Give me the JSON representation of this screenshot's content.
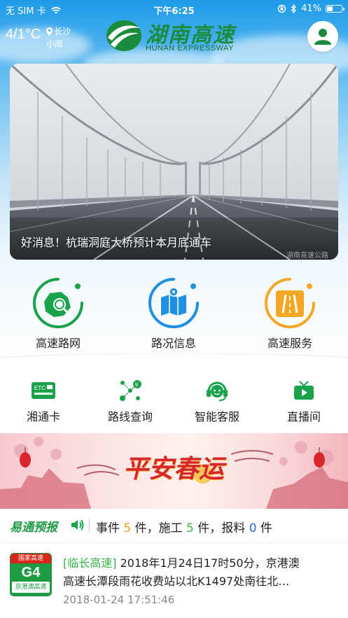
{
  "status_bar": {
    "carrier": "无 SIM 卡",
    "time": "下午6:25",
    "battery": "41%",
    "battery_level": 0.41
  },
  "weather": {
    "temperature": "4/1°C",
    "city": "长沙",
    "condition": "小雨"
  },
  "header": {
    "title_cn": "湖南高速",
    "title_en": "HUNAN EXPRESSWAY",
    "user_icon": "user-icon"
  },
  "banner": {
    "caption": "好消息！杭瑞洞庭大桥预计本月底通车",
    "watermark": "湖南高速公路"
  },
  "main_services": [
    {
      "label": "高速路网",
      "icon": "road-network-icon",
      "color": "#1aa34a"
    },
    {
      "label": "路况信息",
      "icon": "traffic-info-icon",
      "color": "#1f8fe0"
    },
    {
      "label": "高速服务",
      "icon": "highway-service-icon",
      "color": "#f5a623"
    }
  ],
  "quick_links": [
    {
      "label": "湘通卡",
      "icon": "etc-card-icon"
    },
    {
      "label": "路线查询",
      "icon": "route-search-icon"
    },
    {
      "label": "智能客服",
      "icon": "customer-service-icon"
    },
    {
      "label": "直播间",
      "icon": "live-tv-icon"
    }
  ],
  "promo": {
    "title": "平安春运"
  },
  "ticker": {
    "brand": "易通预报",
    "events_label": "事件",
    "events_count": "5",
    "construction_label": "件，施工",
    "construction_count": "5",
    "reports_label": "件，报料",
    "reports_count": "0",
    "suffix": "件"
  },
  "news": {
    "shield_top": "国家高速",
    "shield_code": "G4",
    "shield_bottom": "京港澳高速",
    "tag": "[临长高速]",
    "line1": "2018年1月24日17时50分，京港澳",
    "line2": "高速长潭段雨花收费站以北K1497处南往北…",
    "timestamp": "2018-01-24 17:51:46"
  },
  "colors": {
    "brand_green": "#1a8c3c",
    "accent_orange": "#f39a1c",
    "accent_blue": "#1f6be0"
  }
}
